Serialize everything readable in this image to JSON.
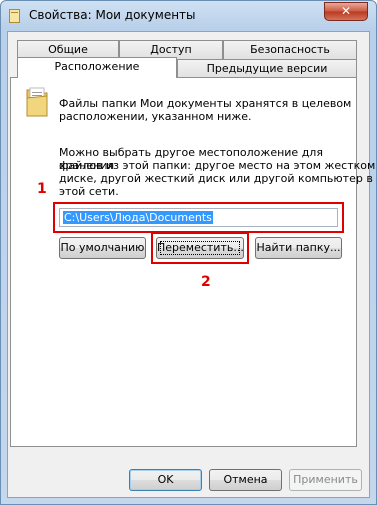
{
  "window": {
    "title": "Свойства: Мои документы",
    "close_label": "✕"
  },
  "tabs": [
    {
      "label": "Общие"
    },
    {
      "label": "Доступ"
    },
    {
      "label": "Безопасность"
    },
    {
      "label": "Расположение"
    },
    {
      "label": "Предыдущие версии"
    }
  ],
  "location": {
    "info_text_line1": "Файлы папки Мои документы хранятся в целевом",
    "info_text_line2": "расположении, указанном ниже.",
    "desc_line1": "Можно выбрать другое местоположение для хранения",
    "desc_line2": "файлов из этой папки: другое место на этом жестком",
    "desc_line3": "диске, другой жесткий диск или другой компьютер в",
    "desc_line4": "этой сети.",
    "path_value": "C:\\Users\\Люда\\Documents",
    "btn_default": "По умолчанию",
    "btn_move": "Переместить...",
    "btn_find": "Найти папку..."
  },
  "annotations": {
    "marker1": "1",
    "marker2": "2",
    "color": "#e00000"
  },
  "footer": {
    "ok": "OK",
    "cancel": "Отмена",
    "apply": "Применить"
  },
  "icons": {
    "title": "folder-properties-icon",
    "folder": "documents-folder-icon"
  }
}
